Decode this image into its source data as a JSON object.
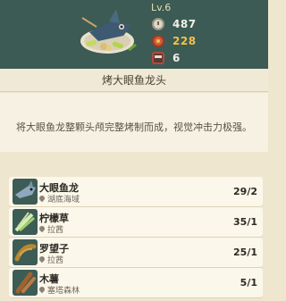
{
  "dish": {
    "level": "Lv.6",
    "stats": [
      {
        "icon": "clock-icon",
        "value": "487",
        "color": "#f3f0e6"
      },
      {
        "icon": "coin-icon",
        "value": "228",
        "color": "#f2c24a"
      },
      {
        "icon": "pot-icon",
        "value": "6",
        "color": "#f3f0e6"
      }
    ]
  },
  "title": "烤大眼鱼龙头",
  "description": "将大眼鱼龙整颗头颅完整烤制而成，视觉冲击力极强。",
  "ingredients": [
    {
      "name": "大眼鱼龙",
      "location": "湖底海域",
      "count": "29/2",
      "icon": "fish-icon"
    },
    {
      "name": "柠檬草",
      "location": "拉茜",
      "count": "35/1",
      "icon": "lemongrass-icon"
    },
    {
      "name": "罗望子",
      "location": "拉茜",
      "count": "25/1",
      "icon": "tamarind-icon"
    },
    {
      "name": "木薯",
      "location": "塞塔森林",
      "count": "5/1",
      "icon": "cassava-icon"
    }
  ]
}
